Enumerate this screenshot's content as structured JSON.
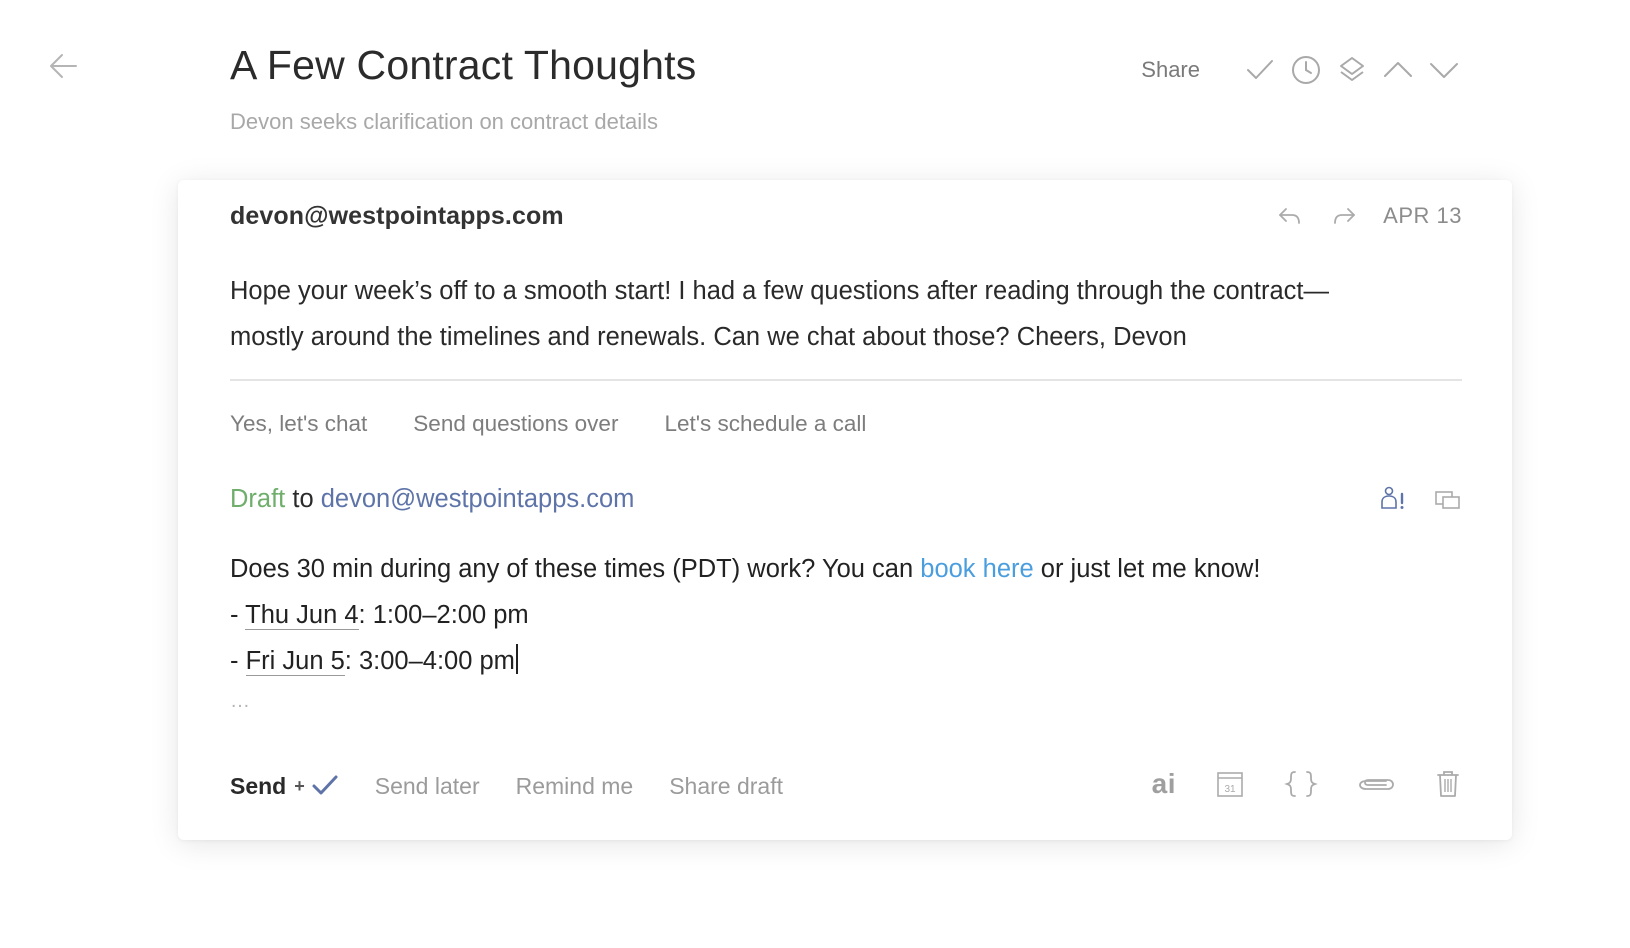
{
  "thread": {
    "title": "A Few Contract Thoughts",
    "subtitle": "Devon seeks clarification on contract details"
  },
  "toolbar": {
    "share_label": "Share",
    "icons": [
      "check-icon",
      "clock-icon",
      "layers-icon",
      "chevron-up-icon",
      "chevron-down-icon"
    ]
  },
  "message": {
    "sender": "devon@westpointapps.com",
    "date": "APR 13",
    "body_line1": "Hope your week’s off to a smooth start! I had a few questions after reading through the contract—",
    "body_line2": "mostly around the timelines and renewals. Can we chat about those? Cheers, Devon"
  },
  "quick_replies": [
    "Yes, let's chat",
    "Send questions over",
    "Let's schedule a call"
  ],
  "draft": {
    "label": "Draft",
    "to_word": "to",
    "recipient": "devon@westpointapps.com",
    "line1_before": "Does 30 min during any of these times (PDT) work? You can ",
    "line1_link": "book here",
    "line1_after": " or just let me know!",
    "slot1_prefix": "- ",
    "slot1_date": "Thu Jun 4",
    "slot1_time": ": 1:00–2:00 pm",
    "slot2_prefix": "- ",
    "slot2_date": "Fri Jun 5",
    "slot2_time": ": 3:00–4:00 pm",
    "ellipsis": "…"
  },
  "footer": {
    "send_label": "Send",
    "send_plus": "+",
    "send_later": "Send later",
    "remind_me": "Remind me",
    "share_draft": "Share draft",
    "ai_label": "ai",
    "calendar_day": "31"
  },
  "colors": {
    "draft_green": "#6fae6b",
    "recipient_blue": "#5e74a8",
    "link_blue": "#4b9ede",
    "send_check": "#5e74a8"
  }
}
